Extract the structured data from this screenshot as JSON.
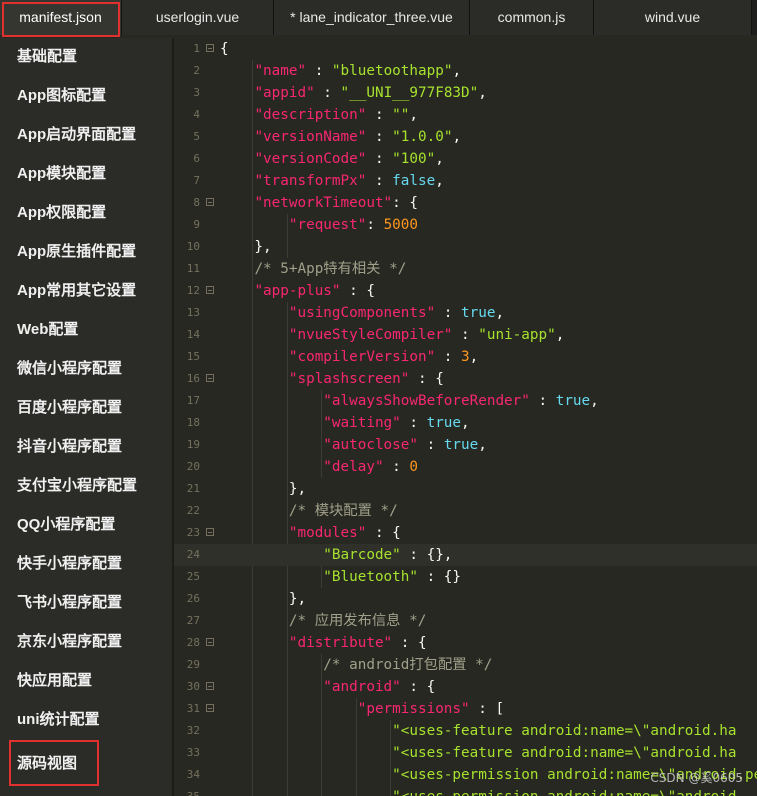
{
  "tabs": [
    {
      "label": "manifest.json",
      "active": true
    },
    {
      "label": "userlogin.vue",
      "active": false
    },
    {
      "label": "* lane_indicator_three.vue",
      "active": false
    },
    {
      "label": "common.js",
      "active": false
    },
    {
      "label": "wind.vue",
      "active": false
    }
  ],
  "sidebar": {
    "items": [
      "基础配置",
      "App图标配置",
      "App启动界面配置",
      "App模块配置",
      "App权限配置",
      "App原生插件配置",
      "App常用其它设置",
      "Web配置",
      "微信小程序配置",
      "百度小程序配置",
      "抖音小程序配置",
      "支付宝小程序配置",
      "QQ小程序配置",
      "快手小程序配置",
      "飞书小程序配置",
      "京东小程序配置",
      "快应用配置",
      "uni统计配置",
      "源码视图"
    ]
  },
  "editor": {
    "lines": [
      {
        "n": "1",
        "fold": true,
        "tokens": [
          [
            "p",
            "{"
          ]
        ]
      },
      {
        "n": "2",
        "tokens": [
          [
            "p",
            "    "
          ],
          [
            "key",
            "\"name\""
          ],
          [
            "p",
            " : "
          ],
          [
            "str",
            "\"bluetoothapp\""
          ],
          [
            "p",
            ","
          ]
        ]
      },
      {
        "n": "3",
        "tokens": [
          [
            "p",
            "    "
          ],
          [
            "key",
            "\"appid\""
          ],
          [
            "p",
            " : "
          ],
          [
            "str",
            "\"__UNI__977F83D\""
          ],
          [
            "p",
            ","
          ]
        ]
      },
      {
        "n": "4",
        "tokens": [
          [
            "p",
            "    "
          ],
          [
            "key",
            "\"description\""
          ],
          [
            "p",
            " : "
          ],
          [
            "str",
            "\"\""
          ],
          [
            "p",
            ","
          ]
        ]
      },
      {
        "n": "5",
        "tokens": [
          [
            "p",
            "    "
          ],
          [
            "key",
            "\"versionName\""
          ],
          [
            "p",
            " : "
          ],
          [
            "str",
            "\"1.0.0\""
          ],
          [
            "p",
            ","
          ]
        ]
      },
      {
        "n": "6",
        "tokens": [
          [
            "p",
            "    "
          ],
          [
            "key",
            "\"versionCode\""
          ],
          [
            "p",
            " : "
          ],
          [
            "str",
            "\"100\""
          ],
          [
            "p",
            ","
          ]
        ]
      },
      {
        "n": "7",
        "tokens": [
          [
            "p",
            "    "
          ],
          [
            "key",
            "\"transformPx\""
          ],
          [
            "p",
            " : "
          ],
          [
            "bool",
            "false"
          ],
          [
            "p",
            ","
          ]
        ]
      },
      {
        "n": "8",
        "fold": true,
        "tokens": [
          [
            "p",
            "    "
          ],
          [
            "key",
            "\"networkTimeout\""
          ],
          [
            "p",
            ": {"
          ]
        ]
      },
      {
        "n": "9",
        "tokens": [
          [
            "p",
            "        "
          ],
          [
            "key",
            "\"request\""
          ],
          [
            "p",
            ": "
          ],
          [
            "num",
            "5000"
          ]
        ]
      },
      {
        "n": "10",
        "tokens": [
          [
            "p",
            "    },"
          ]
        ]
      },
      {
        "n": "11",
        "tokens": [
          [
            "p",
            "    "
          ],
          [
            "com",
            "/* 5+App特有相关 */"
          ]
        ]
      },
      {
        "n": "12",
        "fold": true,
        "tokens": [
          [
            "p",
            "    "
          ],
          [
            "key",
            "\"app-plus\""
          ],
          [
            "p",
            " : {"
          ]
        ]
      },
      {
        "n": "13",
        "tokens": [
          [
            "p",
            "        "
          ],
          [
            "key",
            "\"usingComponents\""
          ],
          [
            "p",
            " : "
          ],
          [
            "bool",
            "true"
          ],
          [
            "p",
            ","
          ]
        ]
      },
      {
        "n": "14",
        "tokens": [
          [
            "p",
            "        "
          ],
          [
            "key",
            "\"nvueStyleCompiler\""
          ],
          [
            "p",
            " : "
          ],
          [
            "str",
            "\"uni-app\""
          ],
          [
            "p",
            ","
          ]
        ]
      },
      {
        "n": "15",
        "tokens": [
          [
            "p",
            "        "
          ],
          [
            "key",
            "\"compilerVersion\""
          ],
          [
            "p",
            " : "
          ],
          [
            "num",
            "3"
          ],
          [
            "p",
            ","
          ]
        ]
      },
      {
        "n": "16",
        "fold": true,
        "tokens": [
          [
            "p",
            "        "
          ],
          [
            "key",
            "\"splashscreen\""
          ],
          [
            "p",
            " : {"
          ]
        ]
      },
      {
        "n": "17",
        "tokens": [
          [
            "p",
            "            "
          ],
          [
            "key",
            "\"alwaysShowBeforeRender\""
          ],
          [
            "p",
            " : "
          ],
          [
            "bool",
            "true"
          ],
          [
            "p",
            ","
          ]
        ]
      },
      {
        "n": "18",
        "tokens": [
          [
            "p",
            "            "
          ],
          [
            "key",
            "\"waiting\""
          ],
          [
            "p",
            " : "
          ],
          [
            "bool",
            "true"
          ],
          [
            "p",
            ","
          ]
        ]
      },
      {
        "n": "19",
        "tokens": [
          [
            "p",
            "            "
          ],
          [
            "key",
            "\"autoclose\""
          ],
          [
            "p",
            " : "
          ],
          [
            "bool",
            "true"
          ],
          [
            "p",
            ","
          ]
        ]
      },
      {
        "n": "20",
        "tokens": [
          [
            "p",
            "            "
          ],
          [
            "key",
            "\"delay\""
          ],
          [
            "p",
            " : "
          ],
          [
            "num",
            "0"
          ]
        ]
      },
      {
        "n": "21",
        "tokens": [
          [
            "p",
            "        },"
          ]
        ]
      },
      {
        "n": "22",
        "tokens": [
          [
            "p",
            "        "
          ],
          [
            "com",
            "/* 模块配置 */"
          ]
        ]
      },
      {
        "n": "23",
        "fold": true,
        "tokens": [
          [
            "p",
            "        "
          ],
          [
            "key",
            "\"modules\""
          ],
          [
            "p",
            " : {"
          ]
        ]
      },
      {
        "n": "24",
        "current": true,
        "tokens": [
          [
            "p",
            "            "
          ],
          [
            "str",
            "\"Barcode\""
          ],
          [
            "p",
            " : {},"
          ]
        ]
      },
      {
        "n": "25",
        "tokens": [
          [
            "p",
            "            "
          ],
          [
            "str",
            "\"Bluetooth\""
          ],
          [
            "p",
            " : {}"
          ]
        ]
      },
      {
        "n": "26",
        "tokens": [
          [
            "p",
            "        },"
          ]
        ]
      },
      {
        "n": "27",
        "tokens": [
          [
            "p",
            "        "
          ],
          [
            "com",
            "/* 应用发布信息 */"
          ]
        ]
      },
      {
        "n": "28",
        "fold": true,
        "tokens": [
          [
            "p",
            "        "
          ],
          [
            "key",
            "\"distribute\""
          ],
          [
            "p",
            " : {"
          ]
        ]
      },
      {
        "n": "29",
        "tokens": [
          [
            "p",
            "            "
          ],
          [
            "com",
            "/* android打包配置 */"
          ]
        ]
      },
      {
        "n": "30",
        "fold": true,
        "tokens": [
          [
            "p",
            "            "
          ],
          [
            "key",
            "\"android\""
          ],
          [
            "p",
            " : {"
          ]
        ]
      },
      {
        "n": "31",
        "fold": true,
        "tokens": [
          [
            "p",
            "                "
          ],
          [
            "key",
            "\"permissions\""
          ],
          [
            "p",
            " : ["
          ]
        ]
      },
      {
        "n": "32",
        "tokens": [
          [
            "p",
            "                    "
          ],
          [
            "str",
            "\"<uses-feature android:name=\\\"android.ha"
          ]
        ]
      },
      {
        "n": "33",
        "tokens": [
          [
            "p",
            "                    "
          ],
          [
            "str",
            "\"<uses-feature android:name=\\\"android.ha"
          ]
        ]
      },
      {
        "n": "34",
        "tokens": [
          [
            "p",
            "                    "
          ],
          [
            "str",
            "\"<uses-permission android:name=\\\"android.pe"
          ]
        ]
      },
      {
        "n": "35",
        "tokens": [
          [
            "p",
            "                    "
          ],
          [
            "str",
            "\"<uses-permission android:name=\\\"android"
          ]
        ]
      }
    ]
  },
  "watermark": "CSDN @奚0605",
  "colors": {
    "key": "#f92672",
    "string": "#a6e22e",
    "boolean": "#66d9ef",
    "number": "#fd971f",
    "comment": "#a0a08a",
    "highlight_box": "#e0312f"
  }
}
